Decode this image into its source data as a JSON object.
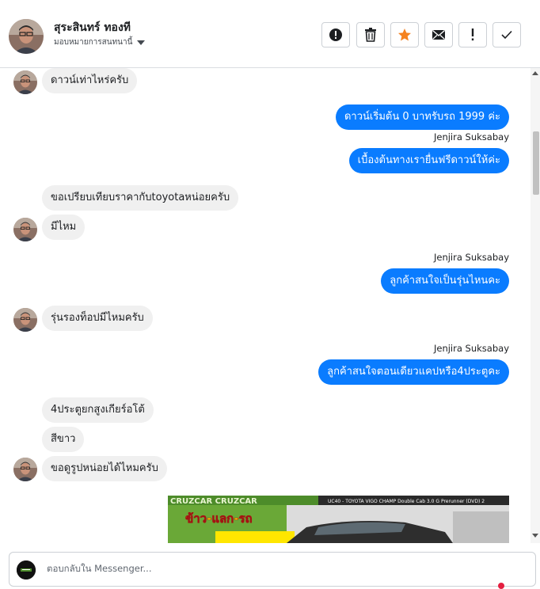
{
  "header": {
    "name": "สุระสินทร์ ทองที",
    "assign_label": "มอบหมายการสนทนานี้"
  },
  "toolbar": {
    "buttons": [
      {
        "name": "info-icon",
        "label": "!"
      },
      {
        "name": "trash-icon",
        "label": ""
      },
      {
        "name": "star-icon",
        "label": ""
      },
      {
        "name": "mail-icon",
        "label": ""
      },
      {
        "name": "exclamation-icon",
        "label": "!"
      },
      {
        "name": "check-icon",
        "label": ""
      }
    ]
  },
  "messages": {
    "m1": "ดาวน์เท่าไหร่ครับ",
    "m2": "ดาวน์เริ่มต้น 0 บาทรับรถ 1999 ค่ะ",
    "m3": "เบื้องต้นทางเรายื่นฟรีดาวน์ให้ค่ะ",
    "m4": "ขอเปรียบเทียบราคากับtoyotaหน่อยครับ",
    "m5": "มีไหม",
    "m6": "ลูกค้าสนใจเป็นรุ่นไหนคะ",
    "m7": "รุ่นรองท็อปมีไหมครับ",
    "m8": "ลูกค้าสนใจตอนเดียวแคปหรือ4ประตูคะ",
    "m9": "4ประตูยกสูงเกียร์อโต้",
    "m10": "สีขาว",
    "m11": "ขอดูรูปหน่อยได้ไหมครับ",
    "agent_name": "Jenjira Suksabay"
  },
  "photo": {
    "banner_text": "CRUZCAR CRUZCAR",
    "caption": "UC40 - TOYOTA VIGO CHAMP Double Cab 3.0 G Prerunner (DVD) 2",
    "promo_text": "ข้าว-แลก-รถ"
  },
  "compose": {
    "placeholder": "ตอบกลับใน Messenger..."
  },
  "colors": {
    "outgoing_bubble": "#0a7cff",
    "incoming_bubble": "#f0f0f0",
    "star": "#f5821f"
  }
}
